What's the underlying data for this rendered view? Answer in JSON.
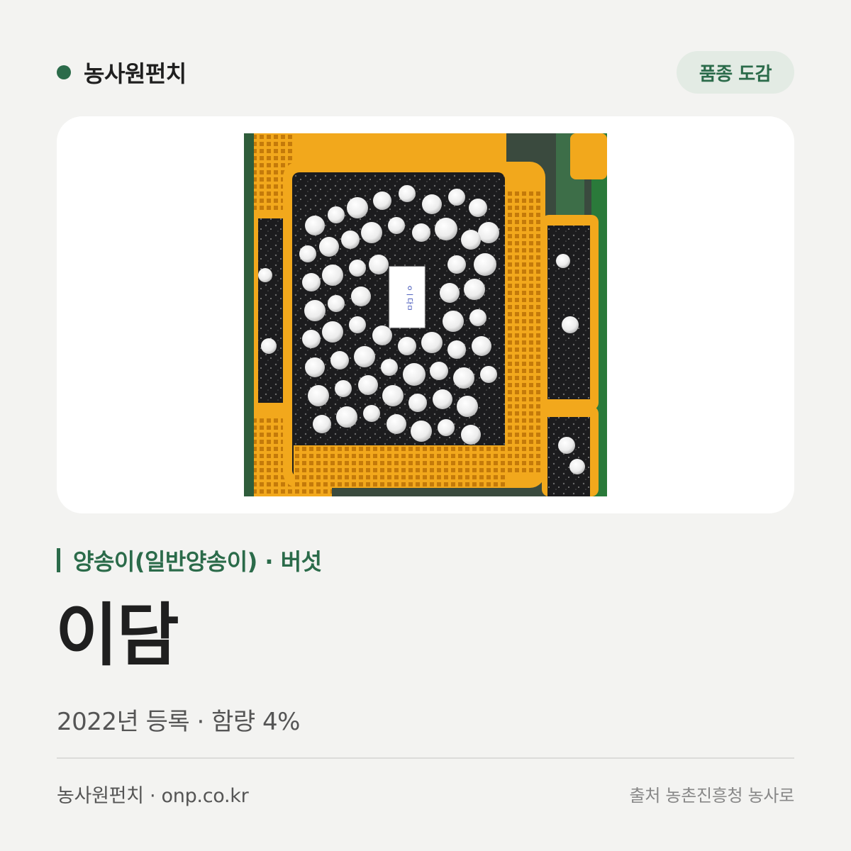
{
  "header": {
    "brand": "농사원펀치",
    "badge": "품종 도감"
  },
  "hero_image": {
    "subject": "white button mushrooms growing in yellow plastic crates",
    "label_on_crate": "ㅇㅣ다ㅁ"
  },
  "variety": {
    "category": "양송이(일반양송이) · 버섯",
    "name": "이담",
    "meta": "2022년 등록 · 함량 4%"
  },
  "footer": {
    "left": "농사원펀치 · onp.co.kr",
    "right": "출처 농촌진흥청 농사로"
  },
  "colors": {
    "accent": "#2b6b4a",
    "background": "#f3f3f1",
    "badge_bg": "#e3ebe4",
    "crate_yellow": "#f2a81c"
  }
}
